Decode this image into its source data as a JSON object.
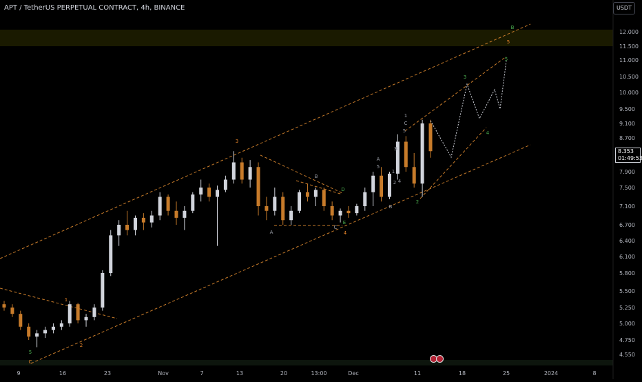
{
  "header": {
    "title": "APT / TetherUS PERPETUAL CONTRACT, 4h, BINANCE"
  },
  "currency_button": "USDT",
  "price_badge": {
    "price": "8.353",
    "countdown": "01:49:53"
  },
  "colors": {
    "background": "#000000",
    "up_candle": "#d1d4dc",
    "down_candle": "#c77b2a",
    "channel_line": "#c77b2a",
    "zone_fill": "#1a1a00",
    "wave_green": "#4caf50",
    "wave_orange": "#e8862a",
    "projection": "#d1d4dc"
  },
  "chart_data": {
    "type": "candlestick",
    "title": "APT / TetherUS PERPETUAL CONTRACT, 4h, BINANCE",
    "ylim": [
      4.45,
      12.35
    ],
    "y_axis_scale": "log",
    "y_ticks": [
      "12.000",
      "11.500",
      "11.000",
      "10.500",
      "10.000",
      "9.500",
      "9.100",
      "8.700",
      "8.300",
      "7.900",
      "7.500",
      "7.100",
      "6.700",
      "6.400",
      "6.100",
      "5.800",
      "5.500",
      "5.250",
      "5.000",
      "4.750",
      "4.550"
    ],
    "x_ticks": [
      "9",
      "16",
      "23",
      "Nov",
      "7",
      "13",
      "20",
      "13:00",
      "Dec",
      "11",
      "18",
      "25",
      "2024",
      "8"
    ],
    "candles_ohlc": [
      [
        5.3,
        5.35,
        5.2,
        5.25
      ],
      [
        5.25,
        5.3,
        5.1,
        5.15
      ],
      [
        5.15,
        5.2,
        4.9,
        4.95
      ],
      [
        4.95,
        5.0,
        4.75,
        4.8
      ],
      [
        4.8,
        4.9,
        4.65,
        4.85
      ],
      [
        4.85,
        4.95,
        4.78,
        4.9
      ],
      [
        4.9,
        5.0,
        4.85,
        4.95
      ],
      [
        4.95,
        5.05,
        4.9,
        5.0
      ],
      [
        5.0,
        5.35,
        4.95,
        5.3
      ],
      [
        5.3,
        5.32,
        5.0,
        5.05
      ],
      [
        5.05,
        5.15,
        4.95,
        5.1
      ],
      [
        5.1,
        5.3,
        5.05,
        5.25
      ],
      [
        5.25,
        5.85,
        5.2,
        5.8
      ],
      [
        5.8,
        6.6,
        5.75,
        6.5
      ],
      [
        6.5,
        6.8,
        6.3,
        6.7
      ],
      [
        6.7,
        7.0,
        6.5,
        6.6
      ],
      [
        6.6,
        6.9,
        6.5,
        6.85
      ],
      [
        6.85,
        6.95,
        6.6,
        6.75
      ],
      [
        6.75,
        7.0,
        6.65,
        6.9
      ],
      [
        6.9,
        7.4,
        6.8,
        7.3
      ],
      [
        7.3,
        7.35,
        6.9,
        7.0
      ],
      [
        7.0,
        7.2,
        6.7,
        6.85
      ],
      [
        6.85,
        7.1,
        6.6,
        7.0
      ],
      [
        7.0,
        7.4,
        6.95,
        7.35
      ],
      [
        7.35,
        7.7,
        7.2,
        7.5
      ],
      [
        7.5,
        7.6,
        7.2,
        7.3
      ],
      [
        7.3,
        7.55,
        6.3,
        7.45
      ],
      [
        7.45,
        7.8,
        7.4,
        7.7
      ],
      [
        7.7,
        8.35,
        7.6,
        8.1
      ],
      [
        8.1,
        8.2,
        7.6,
        7.7
      ],
      [
        7.7,
        8.15,
        7.5,
        8.0
      ],
      [
        8.0,
        8.1,
        6.9,
        7.1
      ],
      [
        7.1,
        7.3,
        6.8,
        7.0
      ],
      [
        7.0,
        7.5,
        6.9,
        7.3
      ],
      [
        7.3,
        7.4,
        6.7,
        6.8
      ],
      [
        6.8,
        7.1,
        6.7,
        7.0
      ],
      [
        7.0,
        7.45,
        6.95,
        7.4
      ],
      [
        7.4,
        7.6,
        7.2,
        7.3
      ],
      [
        7.3,
        7.5,
        7.1,
        7.45
      ],
      [
        7.45,
        7.5,
        7.0,
        7.1
      ],
      [
        7.1,
        7.2,
        6.8,
        6.9
      ],
      [
        6.9,
        7.05,
        6.75,
        7.0
      ],
      [
        7.0,
        7.1,
        6.85,
        6.95
      ],
      [
        6.95,
        7.15,
        6.9,
        7.1
      ],
      [
        7.1,
        7.5,
        7.0,
        7.4
      ],
      [
        7.4,
        7.9,
        7.1,
        7.8
      ],
      [
        7.8,
        8.0,
        7.2,
        7.3
      ],
      [
        7.3,
        7.9,
        7.25,
        7.85
      ],
      [
        7.85,
        8.8,
        7.7,
        8.6
      ],
      [
        8.6,
        8.75,
        7.9,
        8.0
      ],
      [
        8.0,
        8.3,
        7.5,
        7.6
      ],
      [
        7.6,
        9.2,
        7.3,
        9.1
      ],
      [
        9.1,
        9.2,
        8.2,
        8.35
      ]
    ],
    "annotations": [
      {
        "text": "5",
        "color": "wave_green",
        "near": "lower-left"
      },
      {
        "text": "C",
        "color": "wave_orange",
        "near": "bottom-left"
      },
      {
        "text": "1",
        "color": "wave_orange",
        "near": "left"
      },
      {
        "text": "2",
        "color": "wave_orange",
        "near": "left"
      },
      {
        "text": "3",
        "color": "wave_orange",
        "near": "channel-top"
      },
      {
        "text": "A",
        "color": "grey",
        "near": "middle"
      },
      {
        "text": "B",
        "color": "grey",
        "near": "middle"
      },
      {
        "text": "C",
        "color": "grey",
        "near": "middle"
      },
      {
        "text": "D",
        "color": "wave_green",
        "near": "middle"
      },
      {
        "text": "E",
        "color": "wave_green",
        "near": "middle"
      },
      {
        "text": "4",
        "color": "wave_orange",
        "near": "middle-bottom"
      },
      {
        "text": "A",
        "color": "grey",
        "near": "right"
      },
      {
        "text": "5",
        "color": "grey",
        "near": "right"
      },
      {
        "text": "3",
        "color": "grey",
        "near": "right"
      },
      {
        "text": "4",
        "color": "grey",
        "near": "right"
      },
      {
        "text": "1",
        "color": "grey",
        "near": "right"
      },
      {
        "text": "2",
        "color": "grey",
        "near": "right"
      },
      {
        "text": "B",
        "color": "grey",
        "near": "right"
      },
      {
        "text": "1",
        "color": "grey",
        "near": "right-top"
      },
      {
        "text": "C",
        "color": "grey",
        "near": "right-top"
      },
      {
        "text": "5",
        "color": "grey",
        "near": "right-top"
      },
      {
        "text": "3",
        "color": "grey",
        "near": "right-top"
      },
      {
        "text": "2",
        "color": "wave_green",
        "near": "right"
      },
      {
        "text": "3",
        "color": "wave_green",
        "near": "projection"
      },
      {
        "text": "4",
        "color": "wave_green",
        "near": "projection"
      },
      {
        "text": "5",
        "color": "wave_green",
        "near": "projection-top"
      },
      {
        "text": "5",
        "color": "wave_orange",
        "near": "top-right"
      },
      {
        "text": "B",
        "color": "wave_green",
        "near": "top-right"
      }
    ]
  }
}
